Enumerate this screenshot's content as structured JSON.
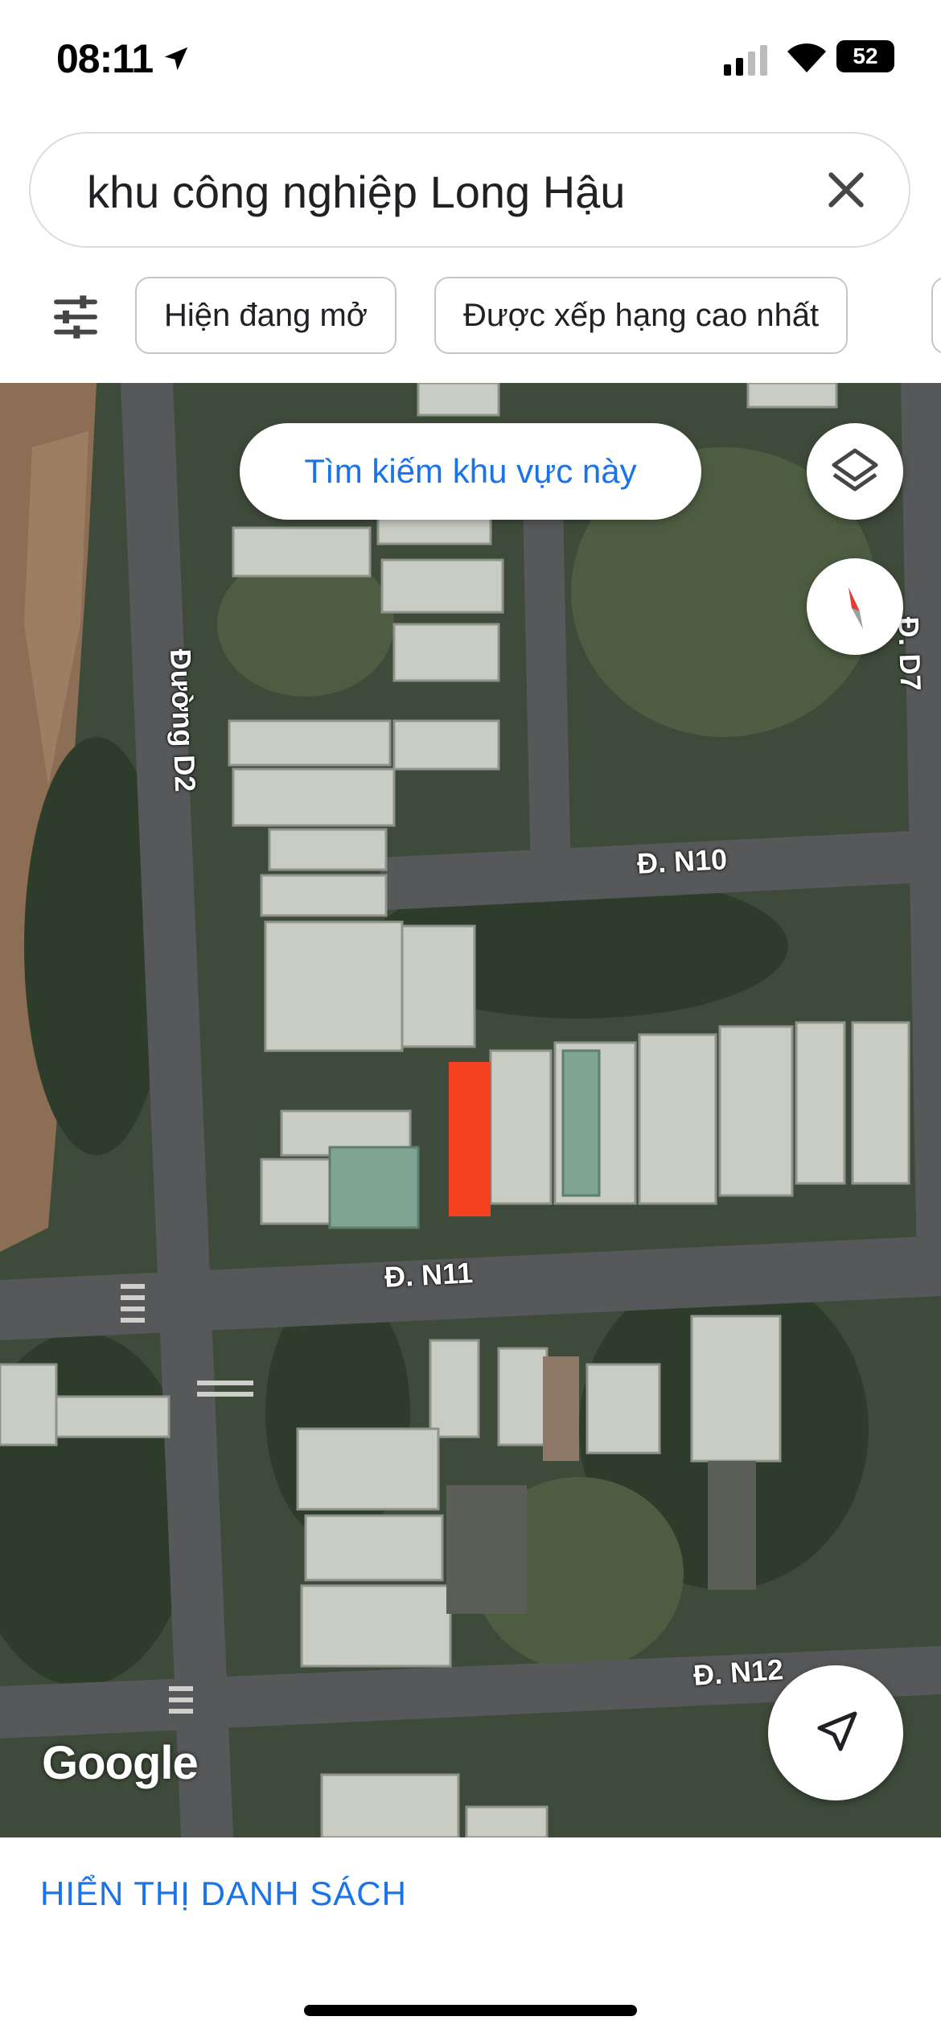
{
  "status_bar": {
    "time": "08:11",
    "battery": "52",
    "icons": [
      "location-arrow-icon",
      "signal-icon",
      "wifi-icon",
      "battery-icon"
    ]
  },
  "search": {
    "query": "khu công nghiệp Long Hậu",
    "clear_icon": "close-icon"
  },
  "filters": {
    "filter_icon": "tune-icon",
    "chips": [
      "Hiện đang mở",
      "Được xếp hạng cao nhất"
    ]
  },
  "map": {
    "search_area_button": "Tìm kiếm khu vực này",
    "road_labels": {
      "d2": "Đường D2",
      "n10": "Đ. N10",
      "n11": "Đ. N11",
      "n12": "Đ. N12",
      "d7": "Đ. D7"
    },
    "attribution": "Google",
    "marker_color": "#f4411e",
    "layer_icon": "layers-icon",
    "compass_icon": "compass-icon",
    "navigation_icon": "navigation-arrow-icon"
  },
  "bottom": {
    "show_list_label": "HIỂN THỊ DANH SÁCH",
    "accent_color": "#1a73e8"
  }
}
